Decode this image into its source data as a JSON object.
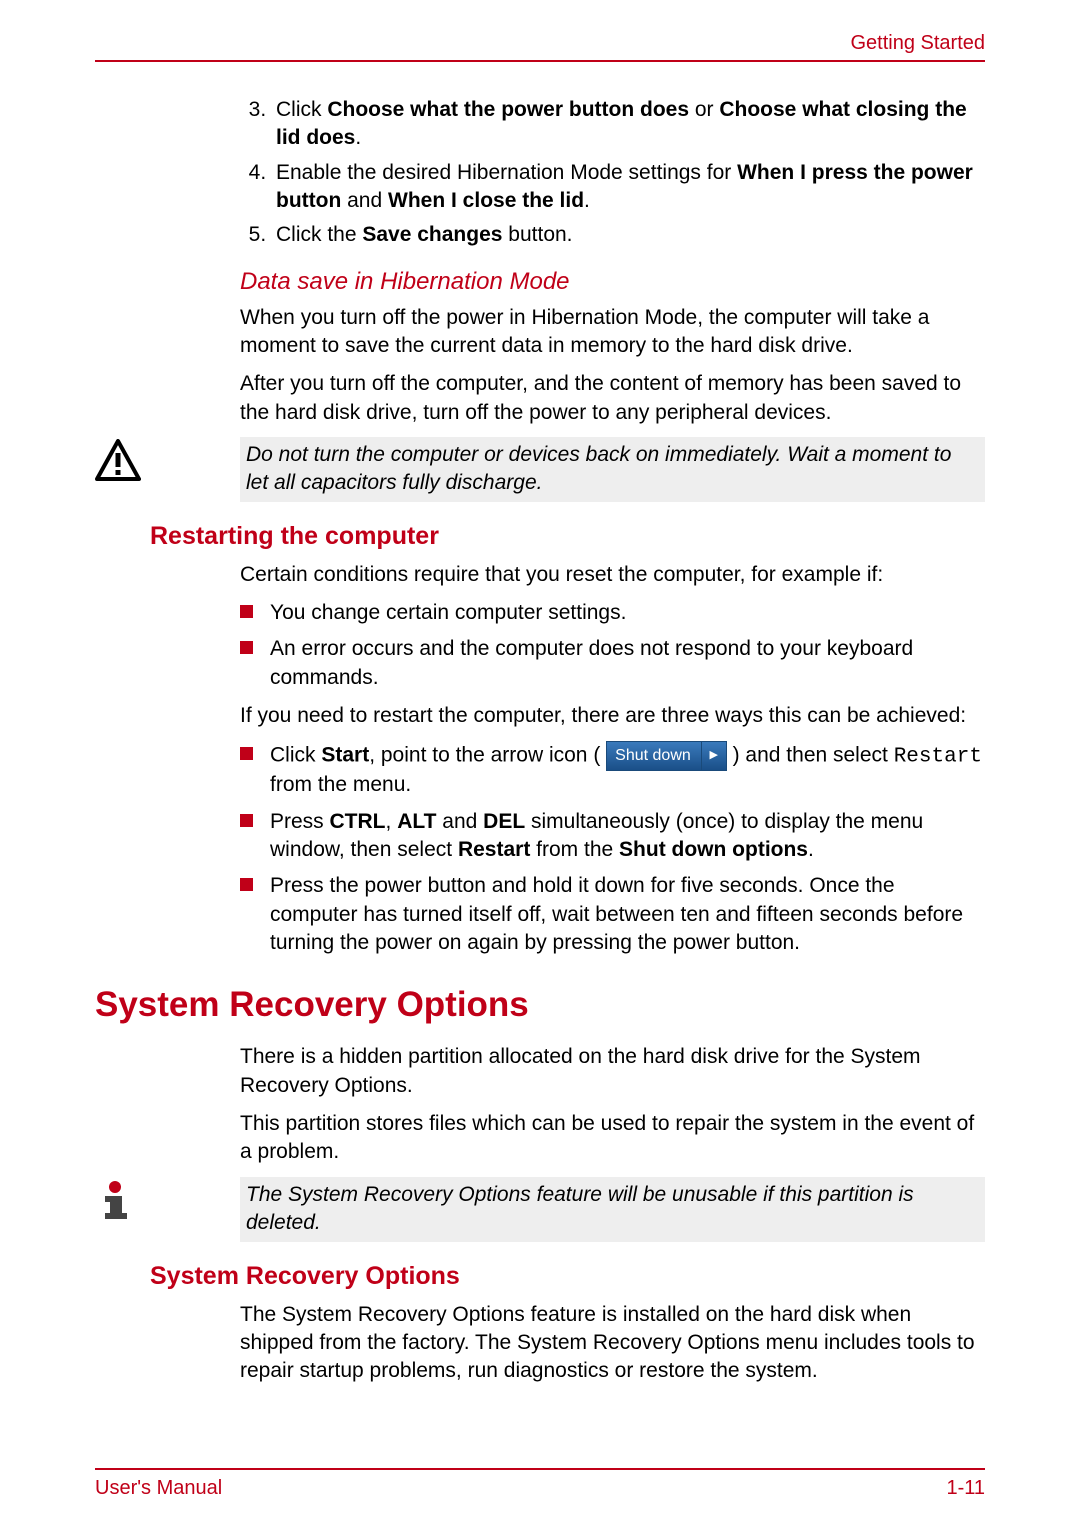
{
  "header": {
    "section": "Getting Started"
  },
  "steps": {
    "s3_a": "Click ",
    "s3_b": "Choose what the power button does",
    "s3_c": " or ",
    "s3_d": "Choose what closing the lid does",
    "s3_e": ".",
    "s4_a": "Enable the desired Hibernation Mode settings for ",
    "s4_b": "When I press the power button",
    "s4_c": " and ",
    "s4_d": "When I close the lid",
    "s4_e": ".",
    "s5_a": "Click the ",
    "s5_b": "Save changes",
    "s5_c": " button."
  },
  "hib": {
    "heading": "Data save in Hibernation Mode",
    "p1": "When you turn off the power in Hibernation Mode, the computer will take a moment to save the current data in memory to the hard disk drive.",
    "p2": "After you turn off the computer, and the content of memory has been saved to the hard disk drive, turn off the power to any peripheral devices.",
    "warn": "Do not turn the computer or devices back on immediately. Wait a moment to let all capacitors fully discharge."
  },
  "restart": {
    "heading": "Restarting the computer",
    "intro": "Certain conditions require that you reset the computer, for example if:",
    "b1": "You change certain computer settings.",
    "b2": "An error occurs and the computer does not respond to your keyboard commands.",
    "mid": "If you need to restart the computer, there are three ways this can be achieved:",
    "m1_a": "Click ",
    "m1_b": "Start",
    "m1_c": ", point to the arrow icon ( ",
    "m1_d": " ) and then select ",
    "m1_e": "Restart",
    "m1_f": " from the menu.",
    "shutdown_label": "Shut down",
    "m2_a": "Press ",
    "m2_b": "CTRL",
    "m2_c": ", ",
    "m2_d": "ALT",
    "m2_e": " and ",
    "m2_f": "DEL",
    "m2_g": " simultaneously (once) to display the menu window, then select ",
    "m2_h": "Restart",
    "m2_i": " from the ",
    "m2_j": "Shut down options",
    "m2_k": ".",
    "m3": "Press the power button and hold it down for five seconds. Once the computer has turned itself off, wait between ten and fifteen seconds before turning the power on again by pressing the power button."
  },
  "sro": {
    "heading": "System Recovery Options",
    "p1": "There is a hidden partition allocated on the hard disk drive for the System Recovery Options.",
    "p2": "This partition stores files which can be used to repair the system in the event of a problem.",
    "note": "The System Recovery Options feature will be unusable if this partition is deleted.",
    "sub_heading": "System Recovery Options",
    "p3": "The System Recovery Options feature is installed on the hard disk when shipped from the factory. The System Recovery Options menu includes tools to repair startup problems, run diagnostics or restore the system."
  },
  "footer": {
    "left": "User's Manual",
    "right": "1-11"
  }
}
